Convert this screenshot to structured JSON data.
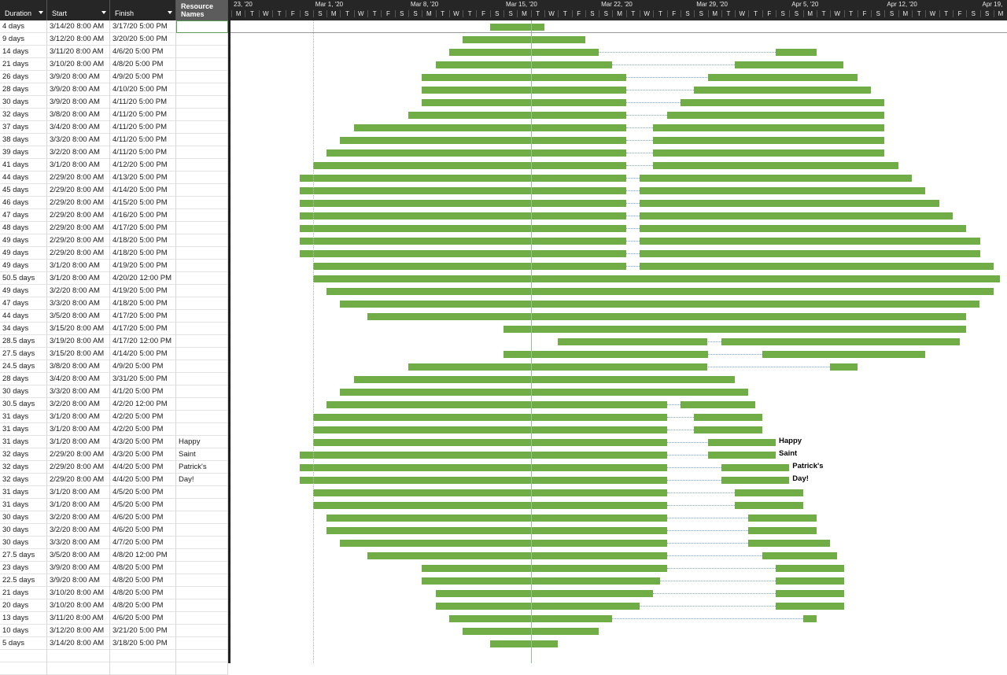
{
  "columns": {
    "duration": "Duration",
    "start": "Start",
    "finish": "Finish",
    "resource_line1": "Resource",
    "resource_line2": "Names"
  },
  "timescale": {
    "week_labels": [
      "23, '20",
      "Mar 1, '20",
      "Mar 8, '20",
      "Mar 15, '20",
      "Mar 22, '20",
      "Mar 29, '20",
      "Apr 5, '20",
      "Apr 12, '20",
      "Apr 19,"
    ],
    "day_letters": [
      "M",
      "T",
      "W",
      "T",
      "F",
      "S",
      "S"
    ]
  },
  "today_marker_color": "#8fc48f",
  "bar_color": "#70ad47",
  "tasks": [
    {
      "duration": "4 days",
      "start": "3/14/20 8:00 AM",
      "finish": "3/17/20 5:00 PM",
      "resource": "",
      "segments": [
        [
          19,
          23
        ]
      ]
    },
    {
      "duration": "9 days",
      "start": "3/12/20 8:00 AM",
      "finish": "3/20/20 5:00 PM",
      "resource": "",
      "segments": [
        [
          17,
          26
        ]
      ]
    },
    {
      "duration": "14 days",
      "start": "3/11/20 8:00 AM",
      "finish": "4/6/20 5:00 PM",
      "resource": "",
      "segments": [
        [
          16,
          27
        ],
        [
          40,
          43
        ]
      ]
    },
    {
      "duration": "21 days",
      "start": "3/10/20 8:00 AM",
      "finish": "4/8/20 5:00 PM",
      "resource": "",
      "segments": [
        [
          15,
          28
        ],
        [
          37,
          45
        ]
      ]
    },
    {
      "duration": "26 days",
      "start": "3/9/20 8:00 AM",
      "finish": "4/9/20 5:00 PM",
      "resource": "",
      "segments": [
        [
          14,
          29
        ],
        [
          35,
          46
        ]
      ]
    },
    {
      "duration": "28 days",
      "start": "3/9/20 8:00 AM",
      "finish": "4/10/20 5:00 PM",
      "resource": "",
      "segments": [
        [
          14,
          29
        ],
        [
          34,
          47
        ]
      ]
    },
    {
      "duration": "30 days",
      "start": "3/9/20 8:00 AM",
      "finish": "4/11/20 5:00 PM",
      "resource": "",
      "segments": [
        [
          14,
          29
        ],
        [
          33,
          48
        ]
      ]
    },
    {
      "duration": "32 days",
      "start": "3/8/20 8:00 AM",
      "finish": "4/11/20 5:00 PM",
      "resource": "",
      "segments": [
        [
          13,
          29
        ],
        [
          32,
          48
        ]
      ]
    },
    {
      "duration": "37 days",
      "start": "3/4/20 8:00 AM",
      "finish": "4/11/20 5:00 PM",
      "resource": "",
      "segments": [
        [
          9,
          29
        ],
        [
          31,
          48
        ]
      ]
    },
    {
      "duration": "38 days",
      "start": "3/3/20 8:00 AM",
      "finish": "4/11/20 5:00 PM",
      "resource": "",
      "segments": [
        [
          8,
          29
        ],
        [
          31,
          48
        ]
      ]
    },
    {
      "duration": "39 days",
      "start": "3/2/20 8:00 AM",
      "finish": "4/11/20 5:00 PM",
      "resource": "",
      "segments": [
        [
          7,
          29
        ],
        [
          31,
          48
        ]
      ]
    },
    {
      "duration": "41 days",
      "start": "3/1/20 8:00 AM",
      "finish": "4/12/20 5:00 PM",
      "resource": "",
      "segments": [
        [
          6,
          29
        ],
        [
          31,
          49
        ]
      ]
    },
    {
      "duration": "44 days",
      "start": "2/29/20 8:00 AM",
      "finish": "4/13/20 5:00 PM",
      "resource": "",
      "segments": [
        [
          5,
          29
        ],
        [
          30,
          50
        ]
      ]
    },
    {
      "duration": "45 days",
      "start": "2/29/20 8:00 AM",
      "finish": "4/14/20 5:00 PM",
      "resource": "",
      "segments": [
        [
          5,
          29
        ],
        [
          30,
          51
        ]
      ]
    },
    {
      "duration": "46 days",
      "start": "2/29/20 8:00 AM",
      "finish": "4/15/20 5:00 PM",
      "resource": "",
      "segments": [
        [
          5,
          29
        ],
        [
          30,
          52
        ]
      ]
    },
    {
      "duration": "47 days",
      "start": "2/29/20 8:00 AM",
      "finish": "4/16/20 5:00 PM",
      "resource": "",
      "segments": [
        [
          5,
          29
        ],
        [
          30,
          53
        ]
      ]
    },
    {
      "duration": "48 days",
      "start": "2/29/20 8:00 AM",
      "finish": "4/17/20 5:00 PM",
      "resource": "",
      "segments": [
        [
          5,
          29
        ],
        [
          30,
          54
        ]
      ]
    },
    {
      "duration": "49 days",
      "start": "2/29/20 8:00 AM",
      "finish": "4/18/20 5:00 PM",
      "resource": "",
      "segments": [
        [
          5,
          29
        ],
        [
          30,
          55
        ]
      ]
    },
    {
      "duration": "49 days",
      "start": "2/29/20 8:00 AM",
      "finish": "4/18/20 5:00 PM",
      "resource": "",
      "segments": [
        [
          5,
          29
        ],
        [
          30,
          55
        ]
      ]
    },
    {
      "duration": "49 days",
      "start": "3/1/20 8:00 AM",
      "finish": "4/19/20 5:00 PM",
      "resource": "",
      "segments": [
        [
          6,
          29
        ],
        [
          30,
          56
        ]
      ]
    },
    {
      "duration": "50.5 days",
      "start": "3/1/20 8:00 AM",
      "finish": "4/20/20 12:00 PM",
      "resource": "",
      "segments": [
        [
          6,
          56.5
        ]
      ]
    },
    {
      "duration": "49 days",
      "start": "3/2/20 8:00 AM",
      "finish": "4/19/20 5:00 PM",
      "resource": "",
      "segments": [
        [
          7,
          56
        ]
      ]
    },
    {
      "duration": "47 days",
      "start": "3/3/20 8:00 AM",
      "finish": "4/18/20 5:00 PM",
      "resource": "",
      "segments": [
        [
          8,
          55
        ]
      ]
    },
    {
      "duration": "44 days",
      "start": "3/5/20 8:00 AM",
      "finish": "4/17/20 5:00 PM",
      "resource": "",
      "segments": [
        [
          10,
          54
        ]
      ]
    },
    {
      "duration": "34 days",
      "start": "3/15/20 8:00 AM",
      "finish": "4/17/20 5:00 PM",
      "resource": "",
      "segments": [
        [
          20,
          54
        ]
      ]
    },
    {
      "duration": "28.5 days",
      "start": "3/19/20 8:00 AM",
      "finish": "4/17/20 12:00 PM",
      "resource": "",
      "segments": [
        [
          24,
          35
        ],
        [
          36,
          53.5
        ]
      ]
    },
    {
      "duration": "27.5 days",
      "start": "3/15/20 8:00 AM",
      "finish": "4/14/20 5:00 PM",
      "resource": "",
      "segments": [
        [
          20,
          35
        ],
        [
          39,
          51
        ]
      ]
    },
    {
      "duration": "24.5 days",
      "start": "3/8/20 8:00 AM",
      "finish": "4/9/20 5:00 PM",
      "resource": "",
      "segments": [
        [
          13,
          35
        ],
        [
          44,
          46
        ]
      ]
    },
    {
      "duration": "28 days",
      "start": "3/4/20 8:00 AM",
      "finish": "3/31/20 5:00 PM",
      "resource": "",
      "segments": [
        [
          9,
          37
        ]
      ]
    },
    {
      "duration": "30 days",
      "start": "3/3/20 8:00 AM",
      "finish": "4/1/20 5:00 PM",
      "resource": "",
      "segments": [
        [
          8,
          38
        ]
      ]
    },
    {
      "duration": "30.5 days",
      "start": "3/2/20 8:00 AM",
      "finish": "4/2/20 12:00 PM",
      "resource": "",
      "segments": [
        [
          7,
          32
        ],
        [
          33,
          38.5
        ]
      ]
    },
    {
      "duration": "31 days",
      "start": "3/1/20 8:00 AM",
      "finish": "4/2/20 5:00 PM",
      "resource": "",
      "segments": [
        [
          6,
          32
        ],
        [
          34,
          39
        ]
      ]
    },
    {
      "duration": "31 days",
      "start": "3/1/20 8:00 AM",
      "finish": "4/2/20 5:00 PM",
      "resource": "",
      "segments": [
        [
          6,
          32
        ],
        [
          34,
          39
        ]
      ]
    },
    {
      "duration": "31 days",
      "start": "3/1/20 8:00 AM",
      "finish": "4/3/20 5:00 PM",
      "resource": "Happy",
      "segments": [
        [
          6,
          32
        ],
        [
          35,
          40
        ]
      ]
    },
    {
      "duration": "32 days",
      "start": "2/29/20 8:00 AM",
      "finish": "4/3/20 5:00 PM",
      "resource": "Saint",
      "segments": [
        [
          5,
          32
        ],
        [
          35,
          40
        ]
      ]
    },
    {
      "duration": "32 days",
      "start": "2/29/20 8:00 AM",
      "finish": "4/4/20 5:00 PM",
      "resource": "Patrick's",
      "segments": [
        [
          5,
          32
        ],
        [
          36,
          41
        ]
      ]
    },
    {
      "duration": "32 days",
      "start": "2/29/20 8:00 AM",
      "finish": "4/4/20 5:00 PM",
      "resource": "Day!",
      "segments": [
        [
          5,
          32
        ],
        [
          36,
          41
        ]
      ]
    },
    {
      "duration": "31 days",
      "start": "3/1/20 8:00 AM",
      "finish": "4/5/20 5:00 PM",
      "resource": "",
      "segments": [
        [
          6,
          32
        ],
        [
          37,
          42
        ]
      ]
    },
    {
      "duration": "31 days",
      "start": "3/1/20 8:00 AM",
      "finish": "4/5/20 5:00 PM",
      "resource": "",
      "segments": [
        [
          6,
          32
        ],
        [
          37,
          42
        ]
      ]
    },
    {
      "duration": "30 days",
      "start": "3/2/20 8:00 AM",
      "finish": "4/6/20 5:00 PM",
      "resource": "",
      "segments": [
        [
          7,
          32
        ],
        [
          38,
          43
        ]
      ]
    },
    {
      "duration": "30 days",
      "start": "3/2/20 8:00 AM",
      "finish": "4/6/20 5:00 PM",
      "resource": "",
      "segments": [
        [
          7,
          32
        ],
        [
          38,
          43
        ]
      ]
    },
    {
      "duration": "30 days",
      "start": "3/3/20 8:00 AM",
      "finish": "4/7/20 5:00 PM",
      "resource": "",
      "segments": [
        [
          8,
          32
        ],
        [
          38,
          44
        ]
      ]
    },
    {
      "duration": "27.5 days",
      "start": "3/5/20 8:00 AM",
      "finish": "4/8/20 12:00 PM",
      "resource": "",
      "segments": [
        [
          10,
          32
        ],
        [
          39,
          44.5
        ]
      ]
    },
    {
      "duration": "23 days",
      "start": "3/9/20 8:00 AM",
      "finish": "4/8/20 5:00 PM",
      "resource": "",
      "segments": [
        [
          14,
          32
        ],
        [
          40,
          45
        ]
      ]
    },
    {
      "duration": "22.5 days",
      "start": "3/9/20 8:00 AM",
      "finish": "4/8/20 5:00 PM",
      "resource": "",
      "segments": [
        [
          14,
          31.5
        ],
        [
          40,
          45
        ]
      ]
    },
    {
      "duration": "21 days",
      "start": "3/10/20 8:00 AM",
      "finish": "4/8/20 5:00 PM",
      "resource": "",
      "segments": [
        [
          15,
          31
        ],
        [
          40,
          45
        ]
      ]
    },
    {
      "duration": "20 days",
      "start": "3/10/20 8:00 AM",
      "finish": "4/8/20 5:00 PM",
      "resource": "",
      "segments": [
        [
          15,
          30
        ],
        [
          40,
          45
        ]
      ]
    },
    {
      "duration": "13 days",
      "start": "3/11/20 8:00 AM",
      "finish": "4/6/20 5:00 PM",
      "resource": "",
      "segments": [
        [
          16,
          28
        ],
        [
          42,
          43
        ]
      ]
    },
    {
      "duration": "10 days",
      "start": "3/12/20 8:00 AM",
      "finish": "3/21/20 5:00 PM",
      "resource": "",
      "segments": [
        [
          17,
          27
        ]
      ]
    },
    {
      "duration": "5 days",
      "start": "3/14/20 8:00 AM",
      "finish": "3/18/20 5:00 PM",
      "resource": "",
      "segments": [
        [
          19,
          24
        ]
      ]
    }
  ],
  "bar_annotations": [
    {
      "row": 33,
      "text": "Happy"
    },
    {
      "row": 34,
      "text": "Saint"
    },
    {
      "row": 35,
      "text": "Patrick's"
    },
    {
      "row": 36,
      "text": "Day!"
    }
  ]
}
